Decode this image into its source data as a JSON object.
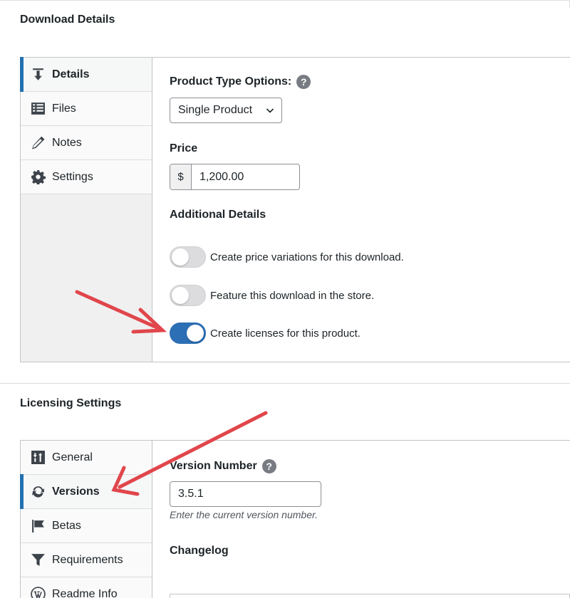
{
  "download_details": {
    "title": "Download Details",
    "tabs": [
      {
        "label": "Details",
        "icon": "download-icon",
        "active": true
      },
      {
        "label": "Files",
        "icon": "list-icon",
        "active": false
      },
      {
        "label": "Notes",
        "icon": "pencil-icon",
        "active": false
      },
      {
        "label": "Settings",
        "icon": "gear-icon",
        "active": false
      }
    ],
    "product_type_label": "Product Type Options:",
    "product_type_value": "Single Product",
    "price_label": "Price",
    "currency_symbol": "$",
    "price_value": "1,200.00",
    "additional_label": "Additional Details",
    "toggles": [
      {
        "label": "Create price variations for this download.",
        "on": false
      },
      {
        "label": "Feature this download in the store.",
        "on": false
      },
      {
        "label": "Create licenses for this product.",
        "on": true
      }
    ]
  },
  "licensing_settings": {
    "title": "Licensing Settings",
    "tabs": [
      {
        "label": "General",
        "icon": "sliders-icon",
        "active": false
      },
      {
        "label": "Versions",
        "icon": "refresh-icon",
        "active": true
      },
      {
        "label": "Betas",
        "icon": "flag-icon",
        "active": false
      },
      {
        "label": "Requirements",
        "icon": "filter-icon",
        "active": false
      },
      {
        "label": "Readme Info",
        "icon": "wordpress-icon",
        "active": false
      }
    ],
    "version_label": "Version Number",
    "version_value": "3.5.1",
    "version_hint": "Enter the current version number.",
    "changelog_label": "Changelog"
  },
  "colors": {
    "accent": "#2271b1",
    "toggle_on": "#2c6fb4",
    "annotation_arrow": "#e0464b"
  }
}
